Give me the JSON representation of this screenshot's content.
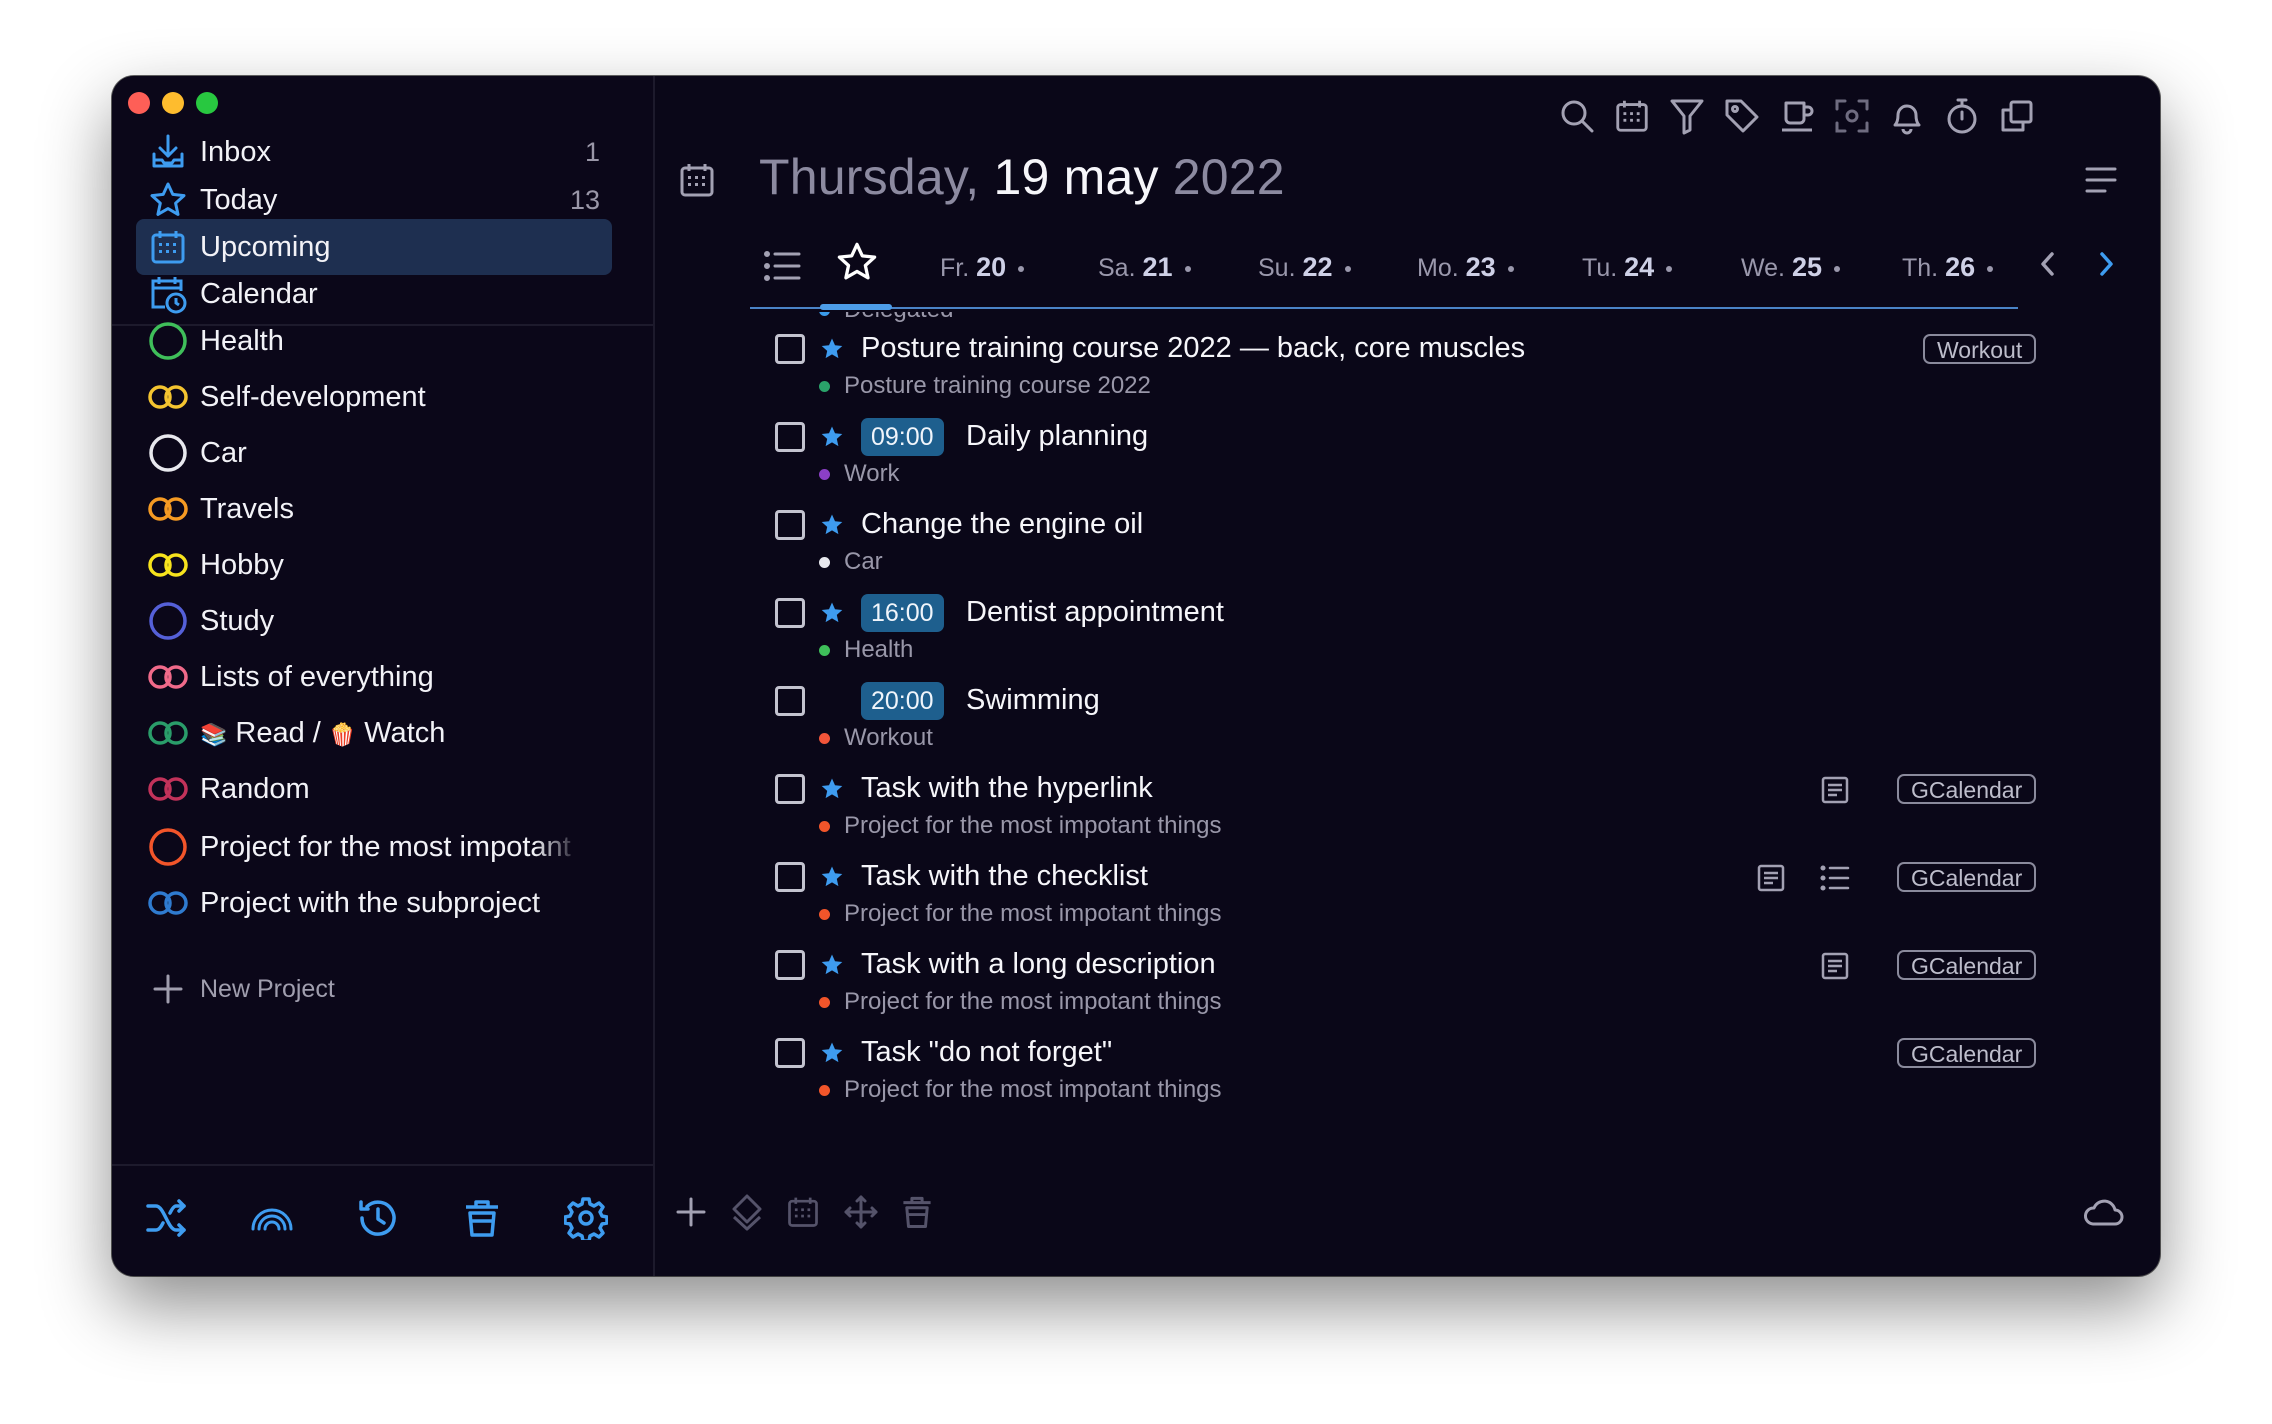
{
  "window": {
    "traffic_lights": {
      "close": "#fe5f57",
      "minimize": "#febc2e",
      "zoom": "#28c840"
    }
  },
  "sidebar": {
    "nav": [
      {
        "label": "Inbox",
        "count": "1",
        "icon": "inbox-icon"
      },
      {
        "label": "Today",
        "count": "13",
        "icon": "star-icon"
      },
      {
        "label": "Upcoming",
        "count": "",
        "icon": "calendar-grid-icon",
        "selected": true
      },
      {
        "label": "Calendar",
        "count": "",
        "icon": "calendar-clock-icon"
      }
    ],
    "projects": [
      {
        "label": "Health",
        "color": "#3fbf5a",
        "icon": "ring-icon"
      },
      {
        "label": "Self-development",
        "color": "#f4c430",
        "icon": "double-ring-icon"
      },
      {
        "label": "Car",
        "color": "#e8e8ee",
        "icon": "ring-icon"
      },
      {
        "label": "Travels",
        "color": "#f59a23",
        "icon": "double-ring-icon"
      },
      {
        "label": "Hobby",
        "color": "#f7e31d",
        "icon": "double-ring-icon"
      },
      {
        "label": "Study",
        "color": "#5560d8",
        "icon": "ring-icon"
      },
      {
        "label": "Lists of everything",
        "color": "#f06a8a",
        "icon": "double-ring-icon"
      },
      {
        "label_a": "Read /",
        "label_b": "Watch",
        "emoji_a": "📚",
        "emoji_b": "🍿",
        "color": "#2a9d6a",
        "icon": "double-ring-icon"
      },
      {
        "label": "Random",
        "color": "#c2325a",
        "icon": "double-ring-icon"
      },
      {
        "label": "Project for the most impotant things",
        "color": "#f2552a",
        "icon": "ring-icon"
      },
      {
        "label": "Project with the subproject",
        "color": "#2f7bd0",
        "icon": "double-ring-icon"
      }
    ],
    "new_project_label": "New Project",
    "bottom_icons": [
      "shuffle-icon",
      "rainbow-icon",
      "history-icon",
      "trash-icon",
      "gear-icon"
    ]
  },
  "toolbar": {
    "icons": [
      "search-icon",
      "calendar-grid-icon",
      "filter-icon",
      "tag-icon",
      "coffee-icon",
      "focus-icon",
      "bell-icon",
      "timer-icon",
      "copy-windows-icon"
    ]
  },
  "header": {
    "date_part1": "Thursday,",
    "date_part2": "19 may",
    "date_part3": "2022",
    "menu_icon": "hamburger-icon"
  },
  "days": [
    {
      "prefix": "Fr.",
      "num": "20"
    },
    {
      "prefix": "Sa.",
      "num": "21"
    },
    {
      "prefix": "Su.",
      "num": "22"
    },
    {
      "prefix": "Mo.",
      "num": "23"
    },
    {
      "prefix": "Tu.",
      "num": "24"
    },
    {
      "prefix": "We.",
      "num": "25"
    },
    {
      "prefix": "Th.",
      "num": "26"
    }
  ],
  "partial_row": {
    "label": "Delegated",
    "color": "#3a9bea"
  },
  "tasks": [
    {
      "title": "Posture training course 2022 — back, core muscles",
      "time": "",
      "project": "Posture training course 2022",
      "project_color": "#2aa36a",
      "tag": "Workout",
      "marker": "star"
    },
    {
      "title": "Daily planning",
      "time": "09:00",
      "project": "Work",
      "project_color": "#8b3fc6",
      "tag": "",
      "marker": "star"
    },
    {
      "title": "Change the engine oil",
      "time": "",
      "project": "Car",
      "project_color": "#e8e8ee",
      "tag": "",
      "marker": "star"
    },
    {
      "title": "Dentist appointment",
      "time": "16:00",
      "project": "Health",
      "project_color": "#3fbf5a",
      "tag": "",
      "marker": "star"
    },
    {
      "title": "Swimming",
      "time": "20:00",
      "project": "Workout",
      "project_color": "#f2553a",
      "tag": "",
      "marker": "moon"
    },
    {
      "title": "Task with the hyperlink",
      "time": "",
      "project": "Project for the most impotant things",
      "project_color": "#f2552a",
      "tag": "GCalendar",
      "marker": "star",
      "note": true
    },
    {
      "title": "Task with the checklist",
      "time": "",
      "project": "Project for the most impotant things",
      "project_color": "#f2552a",
      "tag": "GCalendar",
      "marker": "star",
      "note": true,
      "checklist": true
    },
    {
      "title": "Task with a long description",
      "time": "",
      "project": "Project for the most impotant things",
      "project_color": "#f2552a",
      "tag": "GCalendar",
      "marker": "star",
      "note": true
    },
    {
      "title": "Task \"do not forget\"",
      "time": "",
      "project": "Project for the most impotant things",
      "project_color": "#f2552a",
      "tag": "GCalendar",
      "marker": "star"
    }
  ],
  "colors": {
    "accent": "#3e9cf0",
    "time_badge": "#1e5f8e",
    "selected_nav": "#1e2f50"
  }
}
